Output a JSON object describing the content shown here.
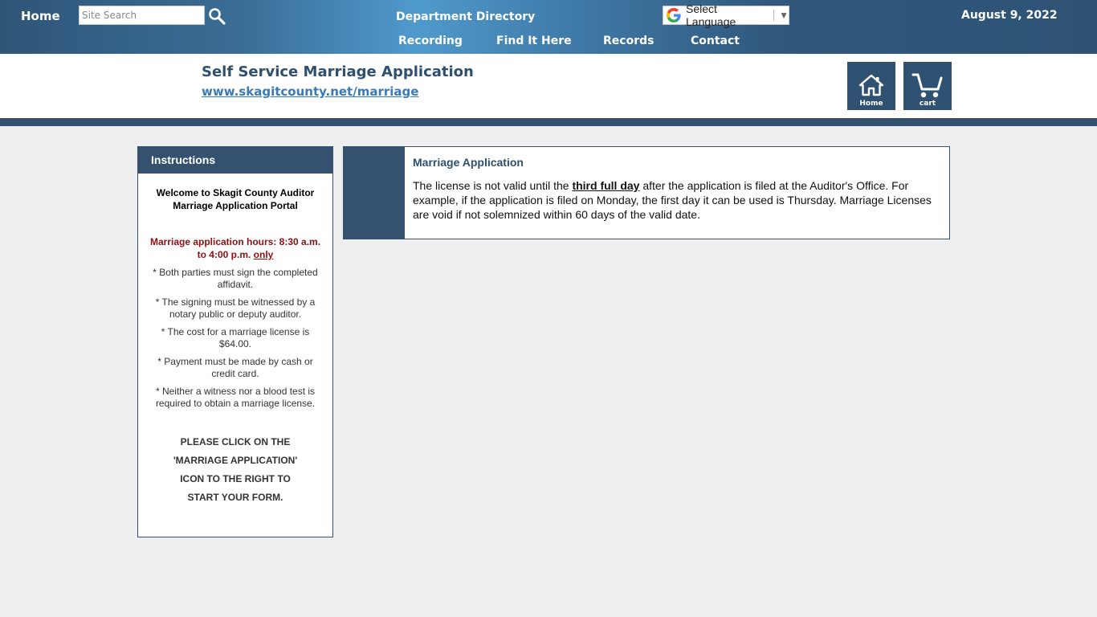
{
  "nav": {
    "home": "Home",
    "search_placeholder": "Site Search",
    "department_directory": "Department Directory",
    "recording": "Recording",
    "find_it_here": "Find It Here",
    "records": "Records",
    "contact": "Contact",
    "language": "Select Language",
    "date": "August 9, 2022"
  },
  "header": {
    "title": "Self Service Marriage Application",
    "url": "www.skagitcounty.net/marriage",
    "home_tile": "Home",
    "cart_tile": "cart"
  },
  "instructions": {
    "heading": "Instructions",
    "welcome": "Welcome to Skagit County Auditor Marriage Application Portal",
    "hours": "Marriage application hours: 8:30 a.m. to 4:00 p.m.",
    "hours_emphasis": "only",
    "bullets": [
      "* Both parties must sign the completed affidavit.",
      "* The signing must be witnessed by a notary public or deputy auditor.",
      "* The cost for a marriage license is $64.00.",
      "* Payment must be made by cash or credit card.",
      "* Neither a witness nor a blood test is required to obtain a marriage license."
    ],
    "cta_lines": [
      "PLEASE CLICK ON THE",
      "'MARRIAGE APPLICATION'",
      "ICON TO THE RIGHT TO",
      "START YOUR FORM."
    ]
  },
  "card": {
    "title": "Marriage Application",
    "text_before": "The license is not valid until the ",
    "text_emphasis": "third full day",
    "text_after": " after the application is filed at the Auditor's Office. For example, if the application is filed on Monday, the first day it can be used is Thursday. Marriage Licenses are void if not solemnized within 60 days of the valid date."
  },
  "colors": {
    "brand_dark": "#34526f",
    "hours_red": "#8b1010",
    "link_blue": "#3a7ab5",
    "page_bg": "#efefef"
  }
}
